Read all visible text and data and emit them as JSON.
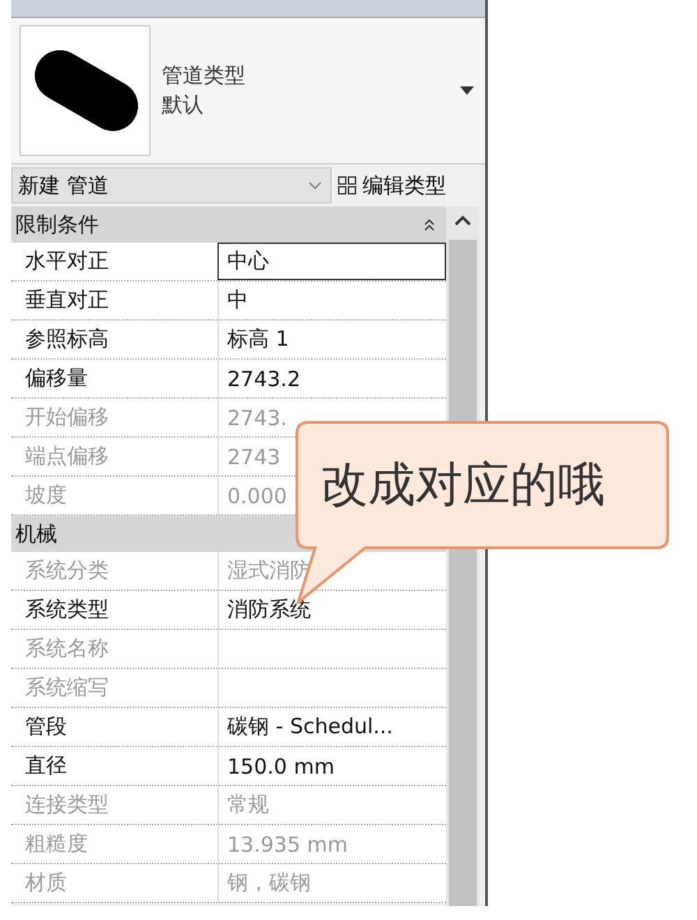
{
  "type_selector": {
    "family": "管道类型",
    "type": "默认"
  },
  "instance_filter": {
    "value": "新建 管道"
  },
  "edit_type_button": {
    "label": "编辑类型"
  },
  "sections": [
    {
      "title": "限制条件",
      "expanded": true,
      "rows": [
        {
          "label": "水平对正",
          "value": "中心",
          "disabled": false,
          "selected": true
        },
        {
          "label": "垂直对正",
          "value": "中",
          "disabled": false,
          "selected": false
        },
        {
          "label": "参照标高",
          "value": "标高 1",
          "disabled": false,
          "selected": false
        },
        {
          "label": "偏移量",
          "value": "2743.2",
          "disabled": false,
          "selected": false
        },
        {
          "label": "开始偏移",
          "value": "2743.",
          "disabled": true,
          "selected": false
        },
        {
          "label": "端点偏移",
          "value": "2743",
          "disabled": true,
          "selected": false
        },
        {
          "label": "坡度",
          "value": "0.000",
          "disabled": true,
          "selected": false
        }
      ]
    },
    {
      "title": "机械",
      "rows": [
        {
          "label": "系统分类",
          "value": "湿式消防",
          "disabled": true,
          "selected": false
        },
        {
          "label": "系统类型",
          "value": "消防系统",
          "disabled": false,
          "selected": false
        },
        {
          "label": "系统名称",
          "disabled": true,
          "selected": false
        },
        {
          "label": "系统缩写",
          "disabled": true,
          "selected": false
        },
        {
          "label": "管段",
          "value": "碳钢 - Schedul...",
          "disabled": false,
          "selected": false
        },
        {
          "label": "直径",
          "value": "150.0 mm",
          "disabled": false,
          "selected": false
        },
        {
          "label": "连接类型",
          "value": "常规",
          "disabled": true,
          "selected": false
        },
        {
          "label": "粗糙度",
          "value": "13.935 mm",
          "disabled": true,
          "selected": false
        },
        {
          "label": "材质",
          "value": "钢，碳钢",
          "disabled": true,
          "selected": false
        }
      ]
    }
  ],
  "callout": {
    "text": "改成对应的哦"
  }
}
